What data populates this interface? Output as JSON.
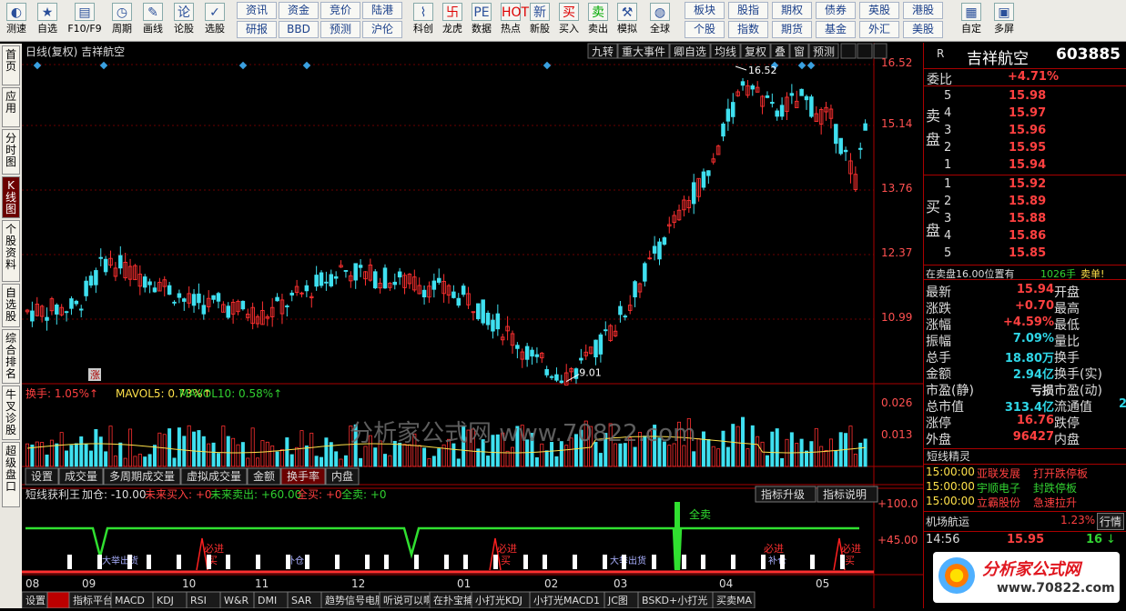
{
  "toolbar": {
    "icons": [
      {
        "label": "测速",
        "icon": "speed-icon"
      },
      {
        "label": "自选",
        "icon": "star-icon"
      },
      {
        "label": "F10/F9",
        "icon": "f10-icon"
      },
      {
        "label": "周期",
        "icon": "clock-icon"
      },
      {
        "label": "画线",
        "icon": "pencil-icon"
      },
      {
        "label": "论股",
        "icon": "lun-icon"
      },
      {
        "label": "选股",
        "icon": "check-icon"
      }
    ],
    "grid_buttons": [
      {
        "top": "资讯",
        "bottom": "研报"
      },
      {
        "top": "资金",
        "bottom": "BBD"
      },
      {
        "top": "竞价",
        "bottom": "预测"
      },
      {
        "top": "陆港",
        "bottom": "沪伦"
      }
    ],
    "icons2": [
      {
        "label": "科创",
        "icon": "sci-icon"
      },
      {
        "label": "龙虎",
        "icon": "dragon-icon"
      },
      {
        "label": "数据",
        "icon": "pe-icon"
      },
      {
        "label": "热点",
        "icon": "hot-icon"
      },
      {
        "label": "新股",
        "icon": "new-icon"
      },
      {
        "label": "买入",
        "icon": "buy-icon"
      },
      {
        "label": "卖出",
        "icon": "sell-icon"
      },
      {
        "label": "模拟",
        "icon": "hammer-icon"
      },
      {
        "label": "全球",
        "icon": "globe-icon"
      }
    ],
    "grid_buttons2": [
      {
        "top": "板块",
        "bottom": "个股"
      },
      {
        "top": "股指",
        "bottom": "指数"
      },
      {
        "top": "期权",
        "bottom": "期货"
      },
      {
        "top": "债券",
        "bottom": "基金"
      },
      {
        "top": "英股",
        "bottom": "外汇"
      },
      {
        "top": "港股",
        "bottom": "美股"
      }
    ],
    "icons3": [
      {
        "label": "自定",
        "icon": "custom-icon"
      },
      {
        "label": "多屏",
        "icon": "multi-icon"
      }
    ]
  },
  "left_tabs": [
    {
      "label": "首页"
    },
    {
      "label": "应用"
    },
    {
      "label": "分时图"
    },
    {
      "label": "K线图"
    },
    {
      "label": "个股资料"
    },
    {
      "label": "自选股"
    },
    {
      "label": "综合排名"
    },
    {
      "label": "牛叉诊股"
    },
    {
      "label": "超级盘口"
    }
  ],
  "chart_header": {
    "title": "日线(复权)  吉祥航空",
    "menu": [
      "九转",
      "重大事件",
      "卿自选",
      "均线",
      "复权",
      "叠",
      "窗",
      "预测"
    ],
    "price_axis": [
      "16.52",
      "15.14",
      "13.76",
      "12.37",
      "10.99"
    ],
    "vol_axis": [
      "0.026",
      "0.013"
    ],
    "ind_axis": [
      "+100.0",
      "+45.00"
    ],
    "high_label": "16.52",
    "low_label": "9.01",
    "zhang": "涨"
  },
  "vol_legend": {
    "a": "换手: 1.05%↑",
    "b": "MAVOL5: 0.73%↑",
    "c": "MAVOL10: 0.58%↑"
  },
  "watermark": "分析家公式网  www.70822.com",
  "vol_tabs": [
    "设置",
    "成交量",
    "多周期成交量",
    "虚拟成交量",
    "金额",
    "换手率",
    "内盘"
  ],
  "ind_legend": {
    "name": "短线获利王",
    "a": "加仓: -10.00",
    "b": "未来买入: +0",
    "c": "未来卖出: +60.00",
    "d": "全买: +0",
    "e": "全卖: +0"
  },
  "ind_buttons": [
    "指标升级",
    "指标说明"
  ],
  "ind_marks": {
    "sell": "全卖",
    "bijin": "必进",
    "buy": "买",
    "dajia": "大举出货",
    "bujin": "补仓"
  },
  "months": [
    "08",
    "09",
    "10",
    "11",
    "12",
    "01",
    "02",
    "03",
    "04",
    "05"
  ],
  "bottom_tabs": [
    "设置",
    "",
    "指标平台",
    "MACD",
    "KDJ",
    "RSI",
    "W&R",
    "DMI",
    "SAR",
    "趋势信号电脑",
    "听说可以啊",
    "在扑宝捕",
    "小打光KDJ",
    "小打光MACD1",
    "JC图",
    "BSKD+小打光",
    "买卖MA"
  ],
  "right_panel": {
    "r": "R",
    "name": "吉祥航空",
    "code": "603885",
    "webi": "委比",
    "webi_val": "+4.71%",
    "sell_label": "卖盘",
    "buy_label": "买盘",
    "asks": [
      {
        "n": "5",
        "p": "15.98"
      },
      {
        "n": "4",
        "p": "15.97"
      },
      {
        "n": "3",
        "p": "15.96"
      },
      {
        "n": "2",
        "p": "15.95"
      },
      {
        "n": "1",
        "p": "15.94"
      }
    ],
    "bids": [
      {
        "n": "1",
        "p": "15.92"
      },
      {
        "n": "2",
        "p": "15.89"
      },
      {
        "n": "3",
        "p": "15.88"
      },
      {
        "n": "4",
        "p": "15.86"
      },
      {
        "n": "5",
        "p": "15.85"
      }
    ],
    "note": "在卖盘16.00位置有",
    "note_hand": "1026手",
    "note_tail": "卖单!",
    "quotes": [
      {
        "k": "最新",
        "v": "15.94",
        "vc": "r",
        "k2": "开盘"
      },
      {
        "k": "涨跌",
        "v": "+0.70",
        "vc": "r",
        "k2": "最高"
      },
      {
        "k": "涨幅",
        "v": "+4.59%",
        "vc": "r",
        "k2": "最低"
      },
      {
        "k": "振幅",
        "v": "7.09%",
        "vc": "c",
        "k2": "量比"
      },
      {
        "k": "总手",
        "v": "18.80万",
        "vc": "c",
        "k2": "换手"
      },
      {
        "k": "金额",
        "v": "2.94亿",
        "vc": "c",
        "k2": "换手(实)"
      },
      {
        "k": "市盈(静)",
        "v": "亏损",
        "vc": "w",
        "k2": "市盈(动)"
      },
      {
        "k": "总市值",
        "v": "313.4亿",
        "vc": "c",
        "k2": "流通值"
      },
      {
        "k": "涨停",
        "v": "16.76",
        "vc": "r",
        "k2": "跌停"
      },
      {
        "k": "外盘",
        "v": "96427",
        "vc": "r",
        "k2": "内盘"
      }
    ],
    "cap_tail": "2",
    "genie_title": "短线精灵",
    "genie": [
      {
        "t": "15:00:00",
        "s": "亚联发展",
        "e": "打开跌停板"
      },
      {
        "t": "15:00:00",
        "s": "宇顺电子",
        "e": "封跌停板"
      },
      {
        "t": "15:00:00",
        "s": "立霸股份",
        "e": "急速拉升"
      }
    ],
    "sector": "机场航运",
    "sector_val": "1.23%",
    "sector_btn": "行情",
    "tick": {
      "time": "14:56",
      "price": "15.95",
      "vol": "16"
    }
  },
  "logo": {
    "text": "分析家公式网",
    "url": "www.70822.com"
  },
  "chart_data": {
    "type": "candlestick",
    "ylim": [
      9.0,
      16.52
    ],
    "high": 16.52,
    "low": 9.01,
    "last_close": 15.94,
    "x_ticks": [
      "08",
      "09",
      "10",
      "11",
      "12",
      "01",
      "02",
      "03",
      "04",
      "05"
    ],
    "colors": {
      "up": "#ff3030",
      "down": "#3fe0f0",
      "background": "#000000"
    }
  }
}
